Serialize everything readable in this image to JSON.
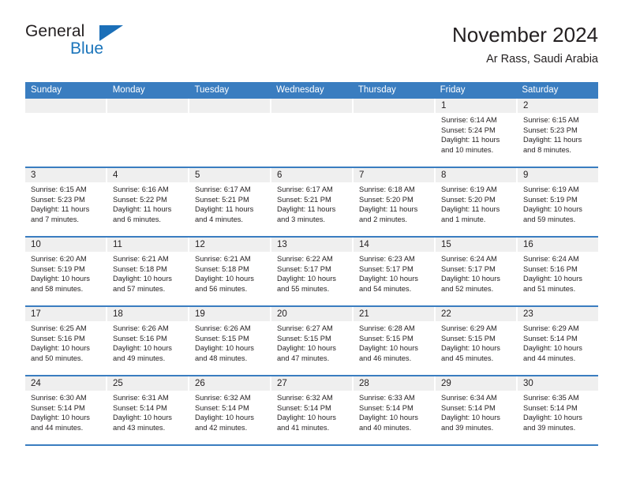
{
  "brand": {
    "word_one": "General",
    "word_two": "Blue",
    "triangle_color": "#1b6fb8"
  },
  "header": {
    "title": "November 2024",
    "location": "Ar Rass, Saudi Arabia"
  },
  "theme": {
    "header_blue": "#3a7dc0",
    "day_number_band": "#efefef",
    "text": "#231f20",
    "brand_blue": "#1b75bb"
  },
  "weekdays": [
    "Sunday",
    "Monday",
    "Tuesday",
    "Wednesday",
    "Thursday",
    "Friday",
    "Saturday"
  ],
  "weeks": [
    [
      {
        "empty": true
      },
      {
        "empty": true
      },
      {
        "empty": true
      },
      {
        "empty": true
      },
      {
        "empty": true
      },
      {
        "day": "1",
        "sunrise": "Sunrise: 6:14 AM",
        "sunset": "Sunset: 5:24 PM",
        "daylight": "Daylight: 11 hours and 10 minutes."
      },
      {
        "day": "2",
        "sunrise": "Sunrise: 6:15 AM",
        "sunset": "Sunset: 5:23 PM",
        "daylight": "Daylight: 11 hours and 8 minutes."
      }
    ],
    [
      {
        "day": "3",
        "sunrise": "Sunrise: 6:15 AM",
        "sunset": "Sunset: 5:23 PM",
        "daylight": "Daylight: 11 hours and 7 minutes."
      },
      {
        "day": "4",
        "sunrise": "Sunrise: 6:16 AM",
        "sunset": "Sunset: 5:22 PM",
        "daylight": "Daylight: 11 hours and 6 minutes."
      },
      {
        "day": "5",
        "sunrise": "Sunrise: 6:17 AM",
        "sunset": "Sunset: 5:21 PM",
        "daylight": "Daylight: 11 hours and 4 minutes."
      },
      {
        "day": "6",
        "sunrise": "Sunrise: 6:17 AM",
        "sunset": "Sunset: 5:21 PM",
        "daylight": "Daylight: 11 hours and 3 minutes."
      },
      {
        "day": "7",
        "sunrise": "Sunrise: 6:18 AM",
        "sunset": "Sunset: 5:20 PM",
        "daylight": "Daylight: 11 hours and 2 minutes."
      },
      {
        "day": "8",
        "sunrise": "Sunrise: 6:19 AM",
        "sunset": "Sunset: 5:20 PM",
        "daylight": "Daylight: 11 hours and 1 minute."
      },
      {
        "day": "9",
        "sunrise": "Sunrise: 6:19 AM",
        "sunset": "Sunset: 5:19 PM",
        "daylight": "Daylight: 10 hours and 59 minutes."
      }
    ],
    [
      {
        "day": "10",
        "sunrise": "Sunrise: 6:20 AM",
        "sunset": "Sunset: 5:19 PM",
        "daylight": "Daylight: 10 hours and 58 minutes."
      },
      {
        "day": "11",
        "sunrise": "Sunrise: 6:21 AM",
        "sunset": "Sunset: 5:18 PM",
        "daylight": "Daylight: 10 hours and 57 minutes."
      },
      {
        "day": "12",
        "sunrise": "Sunrise: 6:21 AM",
        "sunset": "Sunset: 5:18 PM",
        "daylight": "Daylight: 10 hours and 56 minutes."
      },
      {
        "day": "13",
        "sunrise": "Sunrise: 6:22 AM",
        "sunset": "Sunset: 5:17 PM",
        "daylight": "Daylight: 10 hours and 55 minutes."
      },
      {
        "day": "14",
        "sunrise": "Sunrise: 6:23 AM",
        "sunset": "Sunset: 5:17 PM",
        "daylight": "Daylight: 10 hours and 54 minutes."
      },
      {
        "day": "15",
        "sunrise": "Sunrise: 6:24 AM",
        "sunset": "Sunset: 5:17 PM",
        "daylight": "Daylight: 10 hours and 52 minutes."
      },
      {
        "day": "16",
        "sunrise": "Sunrise: 6:24 AM",
        "sunset": "Sunset: 5:16 PM",
        "daylight": "Daylight: 10 hours and 51 minutes."
      }
    ],
    [
      {
        "day": "17",
        "sunrise": "Sunrise: 6:25 AM",
        "sunset": "Sunset: 5:16 PM",
        "daylight": "Daylight: 10 hours and 50 minutes."
      },
      {
        "day": "18",
        "sunrise": "Sunrise: 6:26 AM",
        "sunset": "Sunset: 5:16 PM",
        "daylight": "Daylight: 10 hours and 49 minutes."
      },
      {
        "day": "19",
        "sunrise": "Sunrise: 6:26 AM",
        "sunset": "Sunset: 5:15 PM",
        "daylight": "Daylight: 10 hours and 48 minutes."
      },
      {
        "day": "20",
        "sunrise": "Sunrise: 6:27 AM",
        "sunset": "Sunset: 5:15 PM",
        "daylight": "Daylight: 10 hours and 47 minutes."
      },
      {
        "day": "21",
        "sunrise": "Sunrise: 6:28 AM",
        "sunset": "Sunset: 5:15 PM",
        "daylight": "Daylight: 10 hours and 46 minutes."
      },
      {
        "day": "22",
        "sunrise": "Sunrise: 6:29 AM",
        "sunset": "Sunset: 5:15 PM",
        "daylight": "Daylight: 10 hours and 45 minutes."
      },
      {
        "day": "23",
        "sunrise": "Sunrise: 6:29 AM",
        "sunset": "Sunset: 5:14 PM",
        "daylight": "Daylight: 10 hours and 44 minutes."
      }
    ],
    [
      {
        "day": "24",
        "sunrise": "Sunrise: 6:30 AM",
        "sunset": "Sunset: 5:14 PM",
        "daylight": "Daylight: 10 hours and 44 minutes."
      },
      {
        "day": "25",
        "sunrise": "Sunrise: 6:31 AM",
        "sunset": "Sunset: 5:14 PM",
        "daylight": "Daylight: 10 hours and 43 minutes."
      },
      {
        "day": "26",
        "sunrise": "Sunrise: 6:32 AM",
        "sunset": "Sunset: 5:14 PM",
        "daylight": "Daylight: 10 hours and 42 minutes."
      },
      {
        "day": "27",
        "sunrise": "Sunrise: 6:32 AM",
        "sunset": "Sunset: 5:14 PM",
        "daylight": "Daylight: 10 hours and 41 minutes."
      },
      {
        "day": "28",
        "sunrise": "Sunrise: 6:33 AM",
        "sunset": "Sunset: 5:14 PM",
        "daylight": "Daylight: 10 hours and 40 minutes."
      },
      {
        "day": "29",
        "sunrise": "Sunrise: 6:34 AM",
        "sunset": "Sunset: 5:14 PM",
        "daylight": "Daylight: 10 hours and 39 minutes."
      },
      {
        "day": "30",
        "sunrise": "Sunrise: 6:35 AM",
        "sunset": "Sunset: 5:14 PM",
        "daylight": "Daylight: 10 hours and 39 minutes."
      }
    ]
  ]
}
